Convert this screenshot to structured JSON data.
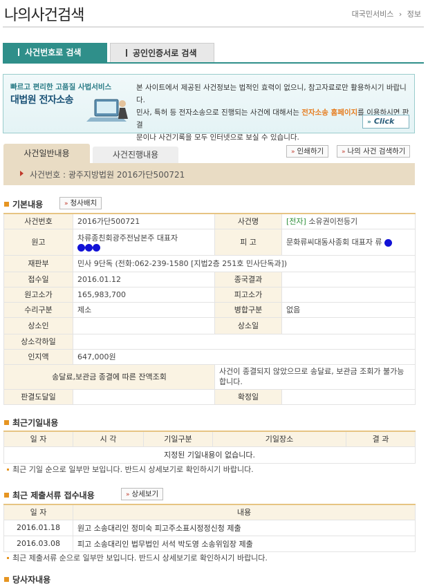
{
  "page": {
    "title": "나의사건검색"
  },
  "breadcrumb": [
    "대국민서비스",
    "정보"
  ],
  "tabs": [
    {
      "label": "사건번호로 검색",
      "active": true
    },
    {
      "label": "공인인증서로 검색",
      "active": false
    }
  ],
  "banner": {
    "sub": "빠르고 편리한 고품질 사법서비스",
    "main": "대법원 전자소송",
    "notice_1": "본 사이트에서 제공된 사건정보는 법적인 효력이 없으니, 참고자료로만 활용하시기 바랍니다.",
    "notice_2a": "민사, 특허 등 전자소송으로 진행되는 사건에 대해서는 ",
    "notice_2_link": "전자소송 홈페이지",
    "notice_2b": "를 이용하시면 판결",
    "notice_3": "문이나 사건기록을 모두 인터넷으로 보실 수 있습니다.",
    "click_label": "Click"
  },
  "sub_tabs": [
    "사건일반내용",
    "사건진행내용"
  ],
  "actions": {
    "print": "인쇄하기",
    "my_search": "나의 사건 검색하기"
  },
  "case_bar": "사건번호 : 광주지방법원 2016가단500721",
  "basic": {
    "heading": "기본내용",
    "button": "청사배치",
    "rows": {
      "case_no_label": "사건번호",
      "case_no": "2016가단500721",
      "case_name_label": "사건명",
      "case_name_tag": "[전자]",
      "case_name": "소유권이전등기",
      "plaintiff_label": "원고",
      "plaintiff": "차류종친회광주전남본주 대표자",
      "defendant_label": "피 고",
      "defendant": "문화류씨대동사종회 대표자 류",
      "division_label": "재판부",
      "division": "민사 9단독 (전화:062-239-1580 [지법2층 251호 민사단독과])",
      "received_label": "접수일",
      "received": "2016.01.12",
      "final_result_label": "종국결과",
      "final_result": "",
      "plaintiff_value_label": "원고소가",
      "plaintiff_value": "165,983,700",
      "defendant_value_label": "피고소가",
      "defendant_value": "",
      "acceptance_label": "수리구분",
      "acceptance": "제소",
      "merge_label": "병합구분",
      "merge": "없음",
      "appellant_label": "상소인",
      "appellant": "",
      "appeal_date_label": "상소일",
      "appeal_date": "",
      "appeal_dismissed_label": "상소각하일",
      "appeal_dismissed": "",
      "stamp_label": "인지액",
      "stamp": "647,000원",
      "balance_label": "송달료,보관금 종결에 따른 잔액조회",
      "balance": "사건이 종결되지 않았으므로 송달료, 보관금 조회가 불가능합니다.",
      "judgment_delivered_label": "판결도달일",
      "judgment_delivered": "",
      "confirmed_label": "확정일",
      "confirmed": ""
    }
  },
  "hearings": {
    "heading": "최근기일내용",
    "columns": [
      "일 자",
      "시 각",
      "기일구분",
      "기일장소",
      "결 과"
    ],
    "empty": "지정된 기일내용이 없습니다.",
    "note": "최근 기일 순으로 일부만 보입니다. 반드시 상세보기로 확인하시기 바랍니다."
  },
  "filings": {
    "heading": "최근 제출서류 접수내용",
    "button": "상세보기",
    "columns": [
      "일 자",
      "내용"
    ],
    "rows": [
      {
        "date": "2016.01.18",
        "content": "원고 소송대리인 정미숙 피고주소표시정정신청 제출"
      },
      {
        "date": "2016.03.08",
        "content": "피고 소송대리인 법무법인 서석 박도영 소송위임장 제출"
      }
    ],
    "note": "최근 제출서류 순으로 일부만 보입니다. 반드시 상세보기로 확인하시기 바랍니다."
  },
  "parties": {
    "heading": "당사자내용"
  }
}
